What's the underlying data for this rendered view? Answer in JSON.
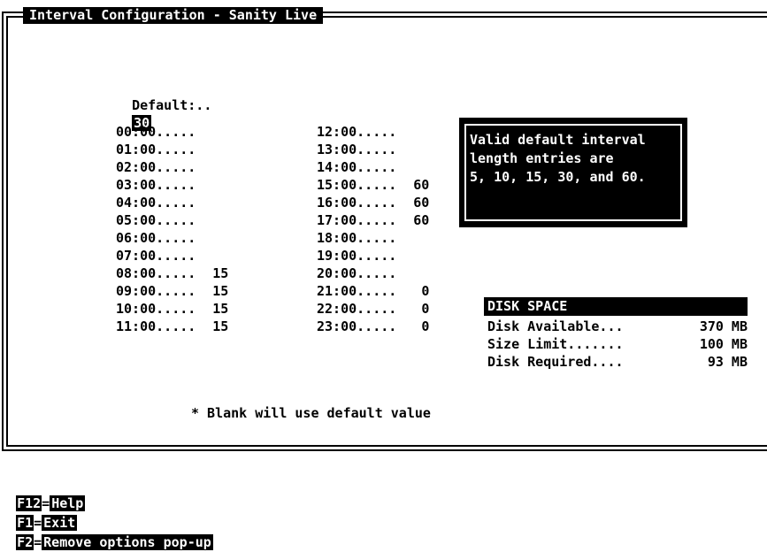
{
  "window": {
    "title": "Interval Configuration - Sanity Live"
  },
  "default_interval": {
    "label": "Default:..",
    "value": "30"
  },
  "intervals_left": [
    {
      "time": "00:00.....",
      "value": ""
    },
    {
      "time": "01:00.....",
      "value": ""
    },
    {
      "time": "02:00.....",
      "value": ""
    },
    {
      "time": "03:00.....",
      "value": ""
    },
    {
      "time": "04:00.....",
      "value": ""
    },
    {
      "time": "05:00.....",
      "value": ""
    },
    {
      "time": "06:00.....",
      "value": ""
    },
    {
      "time": "07:00.....",
      "value": ""
    },
    {
      "time": "08:00.....",
      "value": "15"
    },
    {
      "time": "09:00.....",
      "value": "15"
    },
    {
      "time": "10:00.....",
      "value": "15"
    },
    {
      "time": "11:00.....",
      "value": "15"
    }
  ],
  "intervals_right": [
    {
      "time": "12:00.....",
      "value": ""
    },
    {
      "time": "13:00.....",
      "value": ""
    },
    {
      "time": "14:00.....",
      "value": ""
    },
    {
      "time": "15:00.....",
      "value": "60"
    },
    {
      "time": "16:00.....",
      "value": "60"
    },
    {
      "time": "17:00.....",
      "value": "60"
    },
    {
      "time": "18:00.....",
      "value": ""
    },
    {
      "time": "19:00.....",
      "value": ""
    },
    {
      "time": "20:00.....",
      "value": ""
    },
    {
      "time": "21:00.....",
      "value": "0"
    },
    {
      "time": "22:00.....",
      "value": "0"
    },
    {
      "time": "23:00.....",
      "value": "0"
    }
  ],
  "popup": {
    "lines": [
      "Valid default interval",
      "length entries are",
      "5, 10, 15, 30, and 60."
    ]
  },
  "disk_space": {
    "heading": "DISK SPACE",
    "rows": [
      {
        "label": "Disk Available...",
        "value": "370 MB"
      },
      {
        "label": "Size Limit.......",
        "value": "100 MB"
      },
      {
        "label": "Disk Required....",
        "value": "93 MB"
      }
    ]
  },
  "note": "* Blank will use default value",
  "footer": {
    "keys": [
      {
        "key": "F12",
        "label": "Help"
      },
      {
        "key": "F1",
        "label": "Exit"
      },
      {
        "key": "F2",
        "label": "Remove options pop-up"
      }
    ]
  },
  "colors": {
    "background": "#ffffff",
    "foreground": "#000000"
  }
}
